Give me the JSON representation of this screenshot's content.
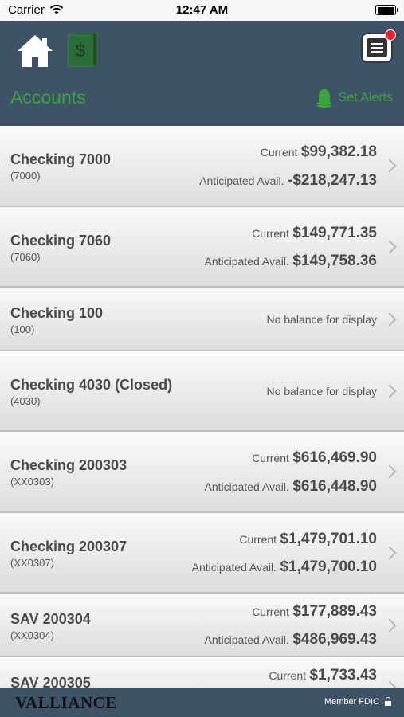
{
  "status_bar": {
    "carrier": "Carrier",
    "time": "12:47 AM"
  },
  "header": {
    "title": "Accounts",
    "set_alerts": "Set Alerts"
  },
  "accounts": [
    {
      "name": "Checking 7000",
      "number": "(7000)",
      "current_label": "Current",
      "current": "$99,382.18",
      "anticipated_label": "Anticipated Avail.",
      "anticipated": "-$218,247.13"
    },
    {
      "name": "Checking 7060",
      "number": "(7060)",
      "current_label": "Current",
      "current": "$149,771.35",
      "anticipated_label": "Anticipated Avail.",
      "anticipated": "$149,758.36"
    },
    {
      "name": "Checking 100",
      "number": "(100)",
      "no_balance": "No balance for display"
    },
    {
      "name": "Checking 4030 (Closed)",
      "number": "(4030)",
      "no_balance": "No balance for display"
    },
    {
      "name": "Checking 200303",
      "number": "(XX0303)",
      "current_label": "Current",
      "current": "$616,469.90",
      "anticipated_label": "Anticipated Avail.",
      "anticipated": "$616,448.90"
    },
    {
      "name": "Checking 200307",
      "number": "(XX0307)",
      "current_label": "Current",
      "current": "$1,479,701.10",
      "anticipated_label": "Anticipated Avail.",
      "anticipated": "$1,479,700.10"
    },
    {
      "name": "SAV 200304",
      "number": "(XX0304)",
      "current_label": "Current",
      "current": "$177,889.43",
      "anticipated_label": "Anticipated Avail.",
      "anticipated": "$486,969.43"
    },
    {
      "name": "SAV 200305",
      "current_label": "Current",
      "current": "$1,733.43"
    }
  ],
  "footer": {
    "brand": "VALLIANCE",
    "member": "Member FDIC"
  },
  "colors": {
    "header_bg": "#3e5268",
    "accent_green": "#3aa63a",
    "badge_red": "#e8212b"
  },
  "icons": {
    "home": "home-icon",
    "money": "money-icon",
    "menu": "menu-icon",
    "bell": "bell-icon",
    "lock": "lock-icon"
  }
}
